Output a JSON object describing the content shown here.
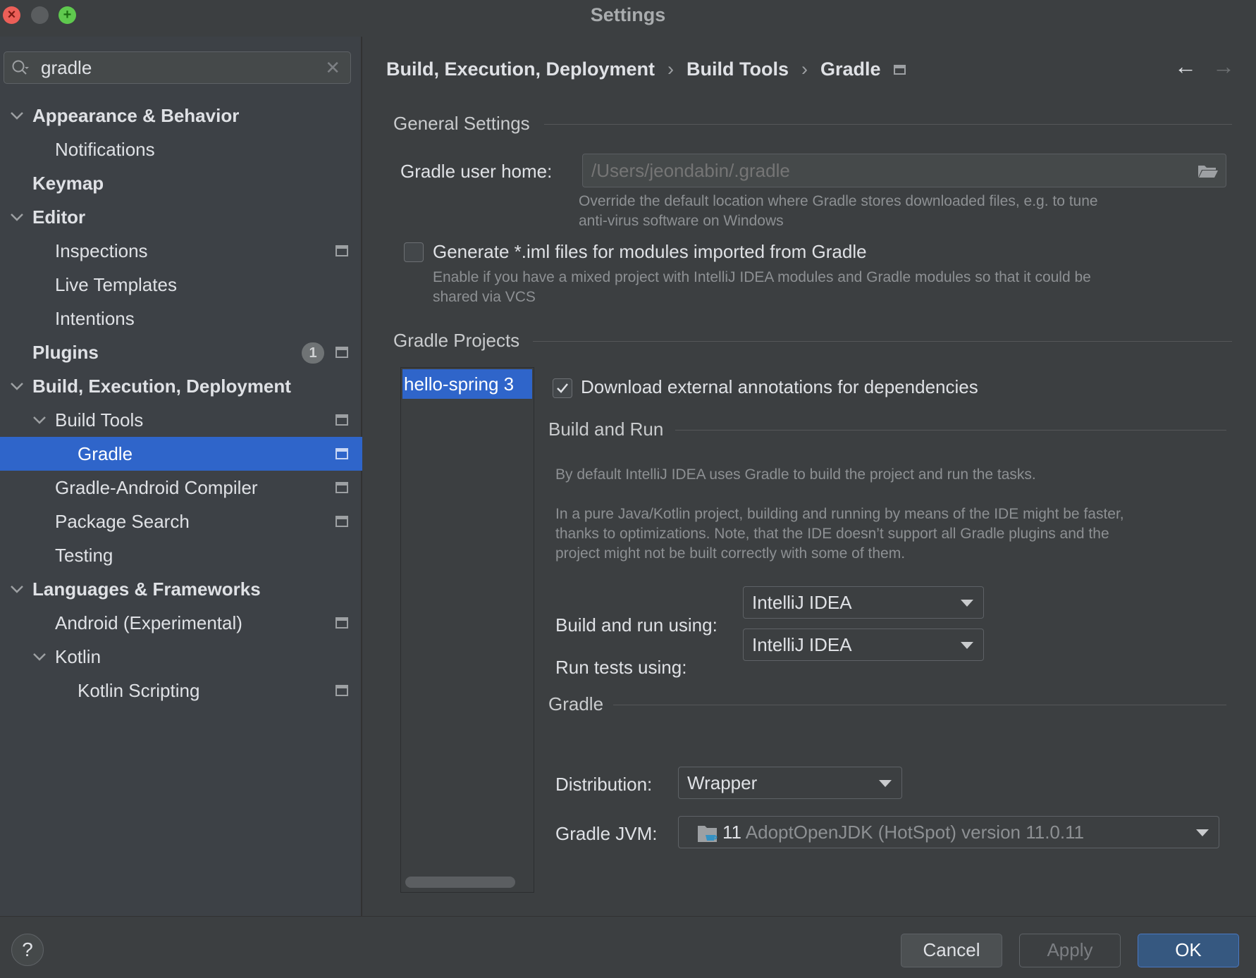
{
  "window": {
    "title": "Settings"
  },
  "search": {
    "value": "gradle"
  },
  "sidebar": {
    "items": [
      {
        "label": "Appearance & Behavior"
      },
      {
        "label": "Notifications"
      },
      {
        "label": "Keymap"
      },
      {
        "label": "Editor"
      },
      {
        "label": "Inspections"
      },
      {
        "label": "Live Templates"
      },
      {
        "label": "Intentions"
      },
      {
        "label": "Plugins",
        "badge": "1"
      },
      {
        "label": "Build, Execution, Deployment"
      },
      {
        "label": "Build Tools"
      },
      {
        "label": "Gradle"
      },
      {
        "label": "Gradle-Android Compiler"
      },
      {
        "label": "Package Search"
      },
      {
        "label": "Testing"
      },
      {
        "label": "Languages & Frameworks"
      },
      {
        "label": "Android (Experimental)"
      },
      {
        "label": "Kotlin"
      },
      {
        "label": "Kotlin Scripting"
      }
    ]
  },
  "breadcrumb": {
    "level1": "Build, Execution, Deployment",
    "level2": "Build Tools",
    "level3": "Gradle"
  },
  "general": {
    "section_title": "General Settings",
    "user_home_label": "Gradle user home:",
    "user_home_placeholder": "/Users/jeondabin/.gradle",
    "user_home_hint_1": "Override the default location where Gradle stores downloaded files, e.g. to tune",
    "user_home_hint_2": "anti-virus software on Windows",
    "iml_label": "Generate *.iml files for modules imported from Gradle",
    "iml_checked": false,
    "iml_hint_1": "Enable if you have a mixed project with IntelliJ IDEA modules and Gradle modules so that it could be",
    "iml_hint_2": "shared via VCS"
  },
  "projects": {
    "section_title": "Gradle Projects",
    "list": [
      "hello-spring 3"
    ],
    "download_annotations_label": "Download external annotations for dependencies",
    "download_annotations_checked": true
  },
  "build_and_run": {
    "section_title": "Build and Run",
    "desc_1": "By default IntelliJ IDEA uses Gradle to build the project and run the tasks.",
    "desc_2": "In a pure Java/Kotlin project, building and running by means of the IDE might be faster,",
    "desc_3": "thanks to optimizations. Note, that the IDE doesn’t support all Gradle plugins and the",
    "desc_4": "project might not be built correctly with some of them.",
    "build_label": "Build and run using:",
    "build_value": "IntelliJ IDEA",
    "tests_label": "Run tests using:",
    "tests_value": "IntelliJ IDEA"
  },
  "gradle": {
    "section_title": "Gradle",
    "distribution_label": "Distribution:",
    "distribution_value": "Wrapper",
    "jvm_label": "Gradle JVM:",
    "jvm_version": "11",
    "jvm_name": "AdoptOpenJDK (HotSpot) version 11.0.11"
  },
  "footer": {
    "help": "?",
    "cancel": "Cancel",
    "apply": "Apply",
    "ok": "OK"
  },
  "colors": {
    "accent": "#2f65ca",
    "ok_button": "#365880",
    "background": "#3c3f41",
    "sidebar": "#3d4146"
  }
}
